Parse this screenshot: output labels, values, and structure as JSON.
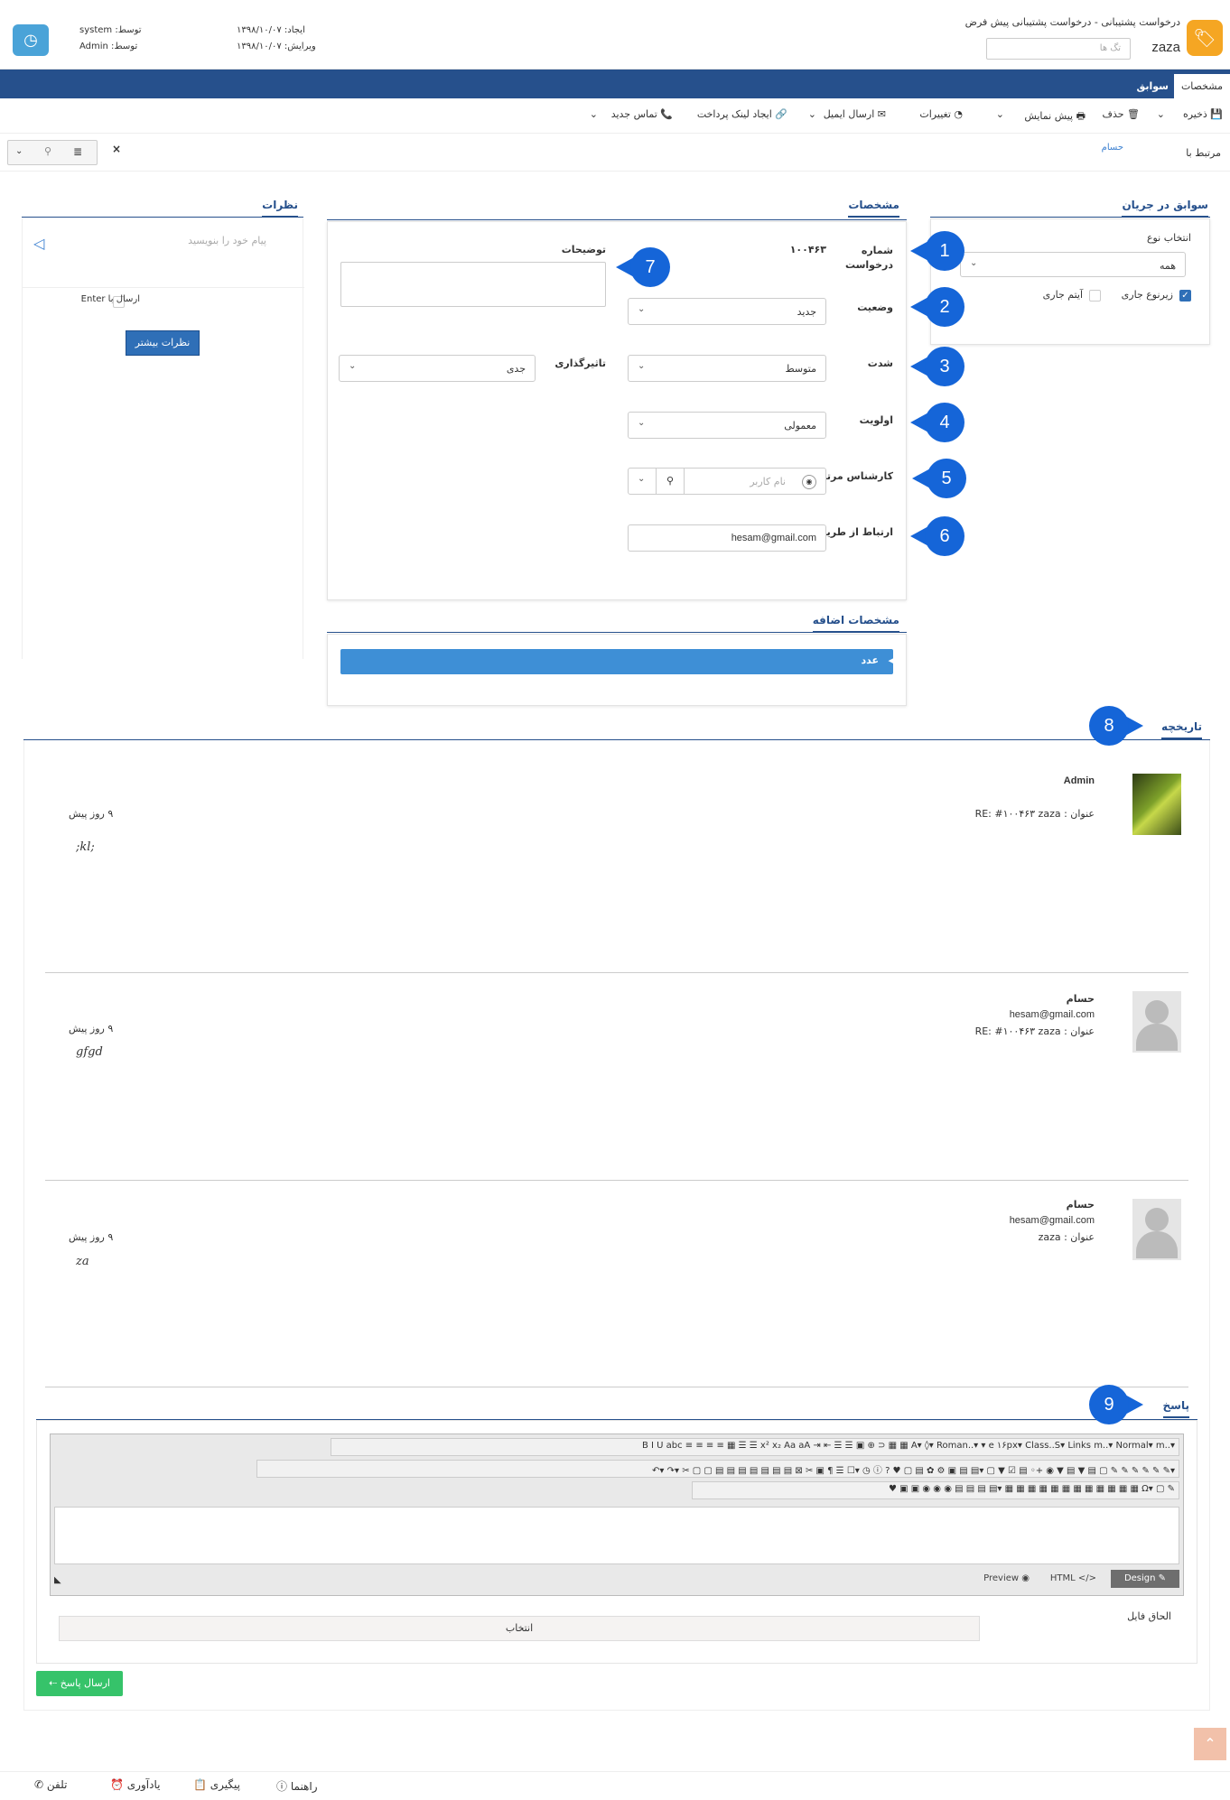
{
  "header": {
    "breadcrumb": "درخواست پشتیبانی - درخواست پشتیبانی پیش فرض",
    "title": "zaza",
    "tags_placeholder": "تگ ها",
    "created_label": "ایجاد: ۱۳۹۸/۱۰/۰۷",
    "edited_label": "ویرایش: ۱۳۹۸/۱۰/۰۷",
    "created_by": "توسط: system",
    "edited_by": "توسط: Admin"
  },
  "tabs": [
    "مشخصات",
    "سوابق"
  ],
  "toolbar": {
    "save": "ذخیره",
    "delete": "حذف",
    "preview": "پیش نمایش",
    "changes": "تغییرات",
    "send_email": "ارسال ایمیل",
    "payment_link": "ایجاد لینک پرداخت",
    "new_contact": "تماس جدید"
  },
  "related": {
    "label": "مرتبط با",
    "value": "حسام"
  },
  "history_panel": {
    "title": "سوابق در جریان",
    "type_label": "انتخاب نوع",
    "type_value": "همه",
    "subtype_label": "زیرنوع جاری",
    "current_item_label": "آیتم جاری"
  },
  "details": {
    "title": "مشخصات",
    "request_number_label": "شماره درخواست",
    "request_number": "۱۰۰۴۶۳",
    "status_label": "وضعیت",
    "status_value": "جدید",
    "severity_label": "شدت",
    "severity_value": "متوسط",
    "priority_label": "اولویت",
    "priority_value": "معمولی",
    "expert_label": "کارشناس مرتبط",
    "expert_placeholder": "نام کاربر",
    "contact_via_label": "ارتباط از طریق",
    "contact_via_value": "hesam@gmail.com",
    "description_label": "توضیحات",
    "impact_label": "تاثیرگذاری",
    "impact_value": "جدی"
  },
  "extra": {
    "title": "مشخصات اضافه",
    "number_label": "عدد"
  },
  "comments": {
    "title": "نظرات",
    "placeholder": "پیام خود را بنویسید",
    "send_enter_label": "ارسال با Enter",
    "more_button": "نظرات بیشتر"
  },
  "badges": [
    "1",
    "2",
    "3",
    "4",
    "5",
    "6",
    "7",
    "8",
    "9"
  ],
  "timeline": {
    "title": "تاریخچه",
    "entries": [
      {
        "author": "Admin",
        "email": "",
        "subject": "عنوان : RE: #۱۰۰۴۶۳ zaza",
        "time": "۹ روز پیش",
        "body": ";kl;"
      },
      {
        "author": "حسام",
        "email": "hesam@gmail.com",
        "subject": "عنوان : RE: #۱۰۰۴۶۳ zaza",
        "time": "۹ روز پیش",
        "body": "gfgd"
      },
      {
        "author": "حسام",
        "email": "hesam@gmail.com",
        "subject": "عنوان : zaza",
        "time": "۹ روز پیش",
        "body": "za"
      }
    ]
  },
  "reply": {
    "title": "پاسخ",
    "attach_label": "الحاق فایل",
    "choose_label": "انتخاب",
    "send_button": "ارسال پاسخ",
    "editor_modes": [
      "Design",
      "HTML",
      "Preview"
    ],
    "editor_row1": "B  I  U  abc  ≡ ≡ ≡ ≡  ▦  ☰ ☰  x² x₂  Aa aA  ⇥ ⇤ ☰ ☰ ▣ ⊕ ⊃ ▦ ▦  A▾ ◊▾  Roman..▾  ▾ e ۱۶px▾  Class..S▾  Links m..▾  Normal▾  m..▾",
    "editor_row2": "↶▾ ↷▾ ✂ ▢ ▢ ▤ ▤ ▤ ▤ ▤ ▤ ▤ ⊠ ✂ ▣ ¶ ☰ ☐▾ ◷ ⓘ ? ♥ ▢ ▤ ✿ ⚙ ▣ ▤ ▤▾ ▢ ▼ ☑ ▤ ◦+ ◉ ▼ ▤ ▼ ▤ ▢ ✎ ✎ ✎ ✎ ✎ ✎▾",
    "editor_row3": "♥ ▣ ▣ ◉ ◉ ◉ ▤ ▤ ▤ ▤▾ ▦ ▦ ▦ ▦ ▦ ▦ ▦ ▦ ▦ ▦ ▦ ▦ Ω▾ ▢ ✎"
  },
  "footer": {
    "phone": "تلفن",
    "reminder": "یادآوری",
    "followup": "پیگیری",
    "guide": "راهنما"
  },
  "colors": {
    "primary": "#26508c",
    "badge": "#1565d8",
    "accent_orange": "#f5a623",
    "extra_bar": "#3e8fd6",
    "send_green": "#36c36a"
  }
}
